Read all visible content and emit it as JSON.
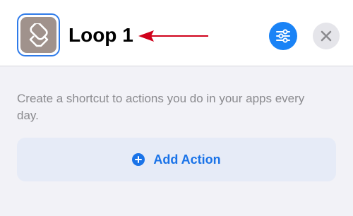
{
  "header": {
    "title": "Loop 1",
    "app_icon": "shortcuts-layers-icon",
    "settings_icon": "sliders-icon",
    "close_icon": "close-icon",
    "colors": {
      "accent": "#1a83f6",
      "icon_bg": "#a0928c",
      "annotation_arrow": "#d0021b"
    }
  },
  "main": {
    "description": "Create a shortcut to actions you do in your apps every day.",
    "add_action": {
      "label": "Add Action",
      "icon": "plus-circle-icon"
    }
  }
}
